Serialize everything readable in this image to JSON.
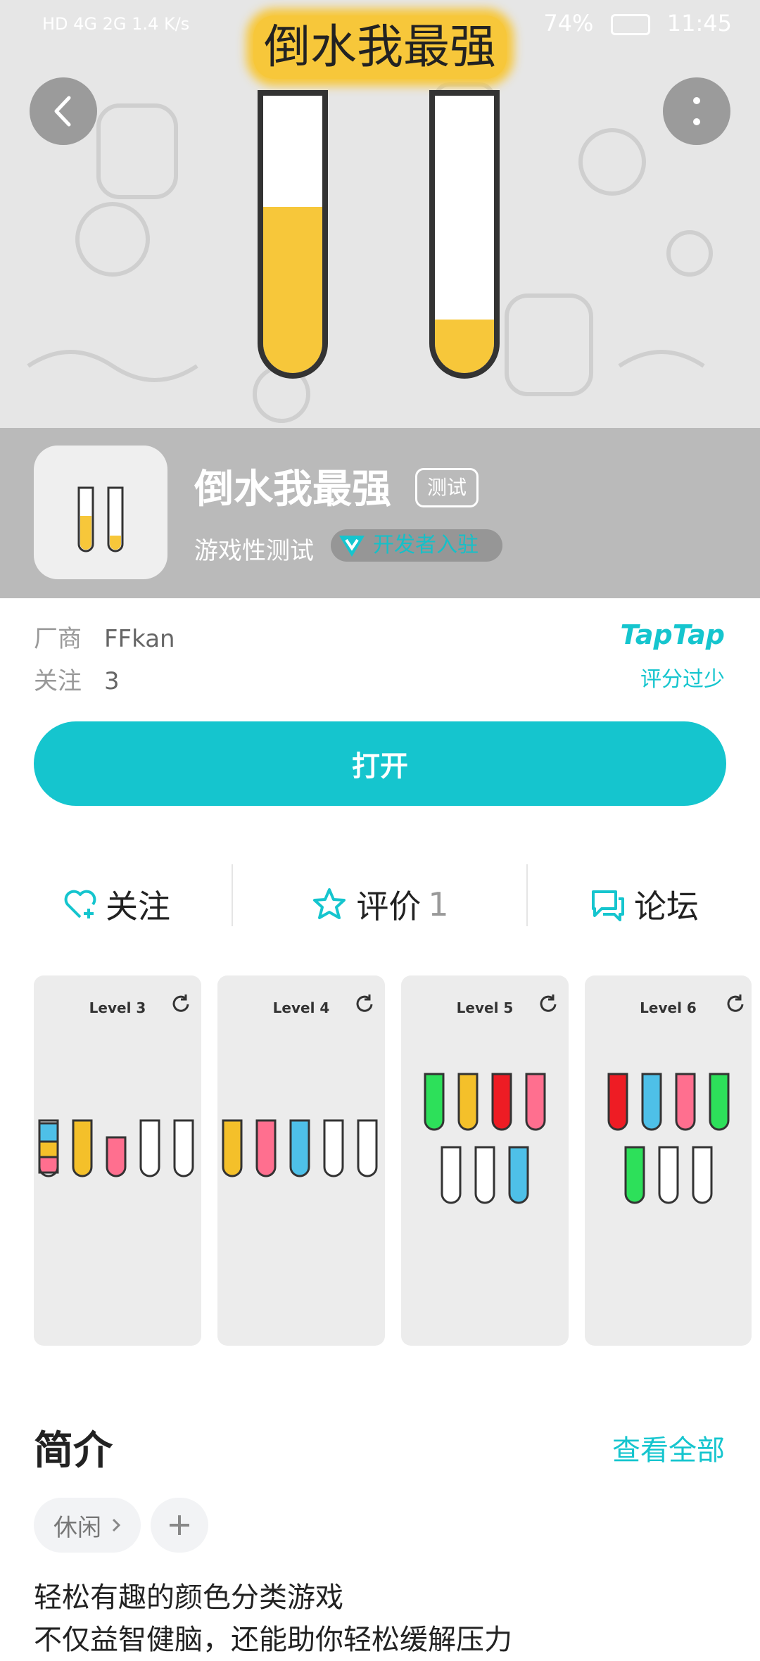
{
  "status_bar": {
    "left": "HD 4G 2G 1.4 K/s",
    "battery": "74%",
    "time": "11:45"
  },
  "hero": {
    "banner_title": "倒水我最强"
  },
  "app": {
    "name": "倒水我最强",
    "badge": "测试",
    "subtitle": "游戏性测试",
    "dev_badge": "开发者入驻"
  },
  "meta": {
    "vendor_label": "厂商",
    "vendor_value": "FFkan",
    "follow_label": "关注",
    "follow_value": "3",
    "platform": "TapTap",
    "rating_note": "评分过少"
  },
  "open_button": "打开",
  "actions": {
    "follow": "关注",
    "review": "评价",
    "review_count": "1",
    "forum": "论坛"
  },
  "screenshots": [
    {
      "level": "Level 3"
    },
    {
      "level": "Level 4"
    },
    {
      "level": "Level 5"
    },
    {
      "level": "Level 6"
    }
  ],
  "intro": {
    "title": "简介",
    "see_all": "查看全部",
    "tag": "休闲",
    "desc_line1": "轻松有趣的颜色分类游戏",
    "desc_line2": "不仅益智健脑，还能助你轻松缓解压力"
  },
  "colors": {
    "accent": "#15c5ce",
    "liquid": "#f7c73a"
  },
  "icons": [
    "back-arrow-icon",
    "more-vertical-icon",
    "heart-plus-icon",
    "star-icon",
    "chat-bubbles-icon",
    "chevron-right-icon",
    "plus-icon",
    "restart-icon"
  ]
}
